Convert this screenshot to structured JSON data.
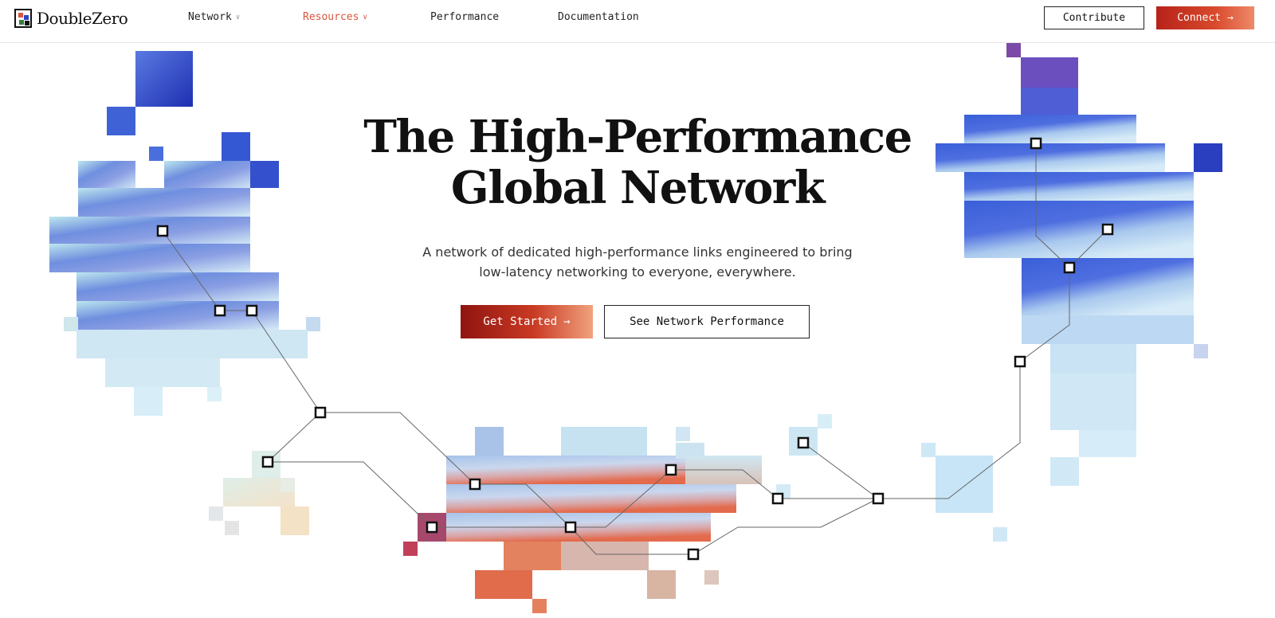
{
  "brand": {
    "name": "DoubleZero",
    "logo_icon": "doublezero-logo-icon"
  },
  "nav": {
    "items": [
      {
        "label": "Network",
        "has_dropdown": true,
        "active": false
      },
      {
        "label": "Resources",
        "has_dropdown": true,
        "active": true
      },
      {
        "label": "Performance",
        "has_dropdown": false,
        "active": false
      },
      {
        "label": "Documentation",
        "has_dropdown": false,
        "active": false
      }
    ],
    "contribute_label": "Contribute",
    "connect_label": "Connect",
    "connect_icon": "arrow-right-icon",
    "active_color": "#d9553f"
  },
  "hero": {
    "title_line1": "The High-Performance",
    "title_line2": "Global Network",
    "subtitle_line1": "A network of dedicated high-performance links engineered to bring",
    "subtitle_line2": "low-latency networking to everyone, everywhere.",
    "primary_cta": "Get Started",
    "primary_cta_icon": "arrow-right-icon",
    "secondary_cta": "See Network Performance"
  },
  "colors": {
    "brand_red": "#c93a23",
    "accent_blue": "#2b44c9",
    "light_blue": "#bfe3f4"
  }
}
